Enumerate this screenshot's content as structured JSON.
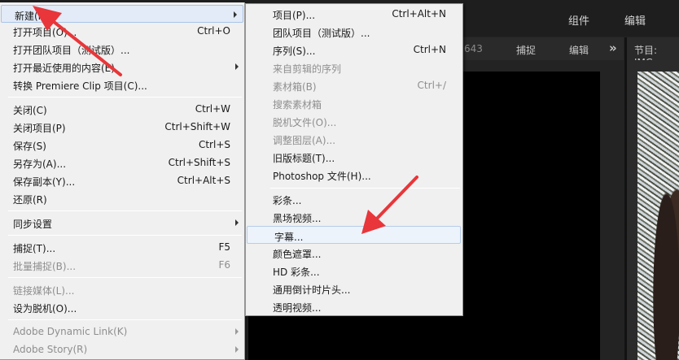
{
  "workspace": {
    "tab_assembly": "组件",
    "tab_editing": "编辑"
  },
  "source_panel": {
    "clip_suffix": "643",
    "tab_capture": "捕捉",
    "tab_edit": "编辑",
    "expand_glyph": "»"
  },
  "program_panel": {
    "title": "节目: IMG"
  },
  "file_menu": {
    "items": [
      {
        "label": "新建(N)",
        "shortcut": "",
        "submenu": true,
        "disabled": false,
        "highlighted": true
      },
      {
        "label": "打开项目(O)...",
        "shortcut": "Ctrl+O",
        "submenu": false,
        "disabled": false
      },
      {
        "label": "打开团队项目（测试版）...",
        "shortcut": "",
        "submenu": false,
        "disabled": false
      },
      {
        "label": "打开最近使用的内容(E)",
        "shortcut": "",
        "submenu": true,
        "disabled": false
      },
      {
        "label": "转换 Premiere Clip 项目(C)...",
        "shortcut": "",
        "submenu": false,
        "disabled": false
      },
      {
        "label": "关闭(C)",
        "shortcut": "Ctrl+W",
        "submenu": false,
        "disabled": false
      },
      {
        "label": "关闭项目(P)",
        "shortcut": "Ctrl+Shift+W",
        "submenu": false,
        "disabled": false
      },
      {
        "label": "保存(S)",
        "shortcut": "Ctrl+S",
        "submenu": false,
        "disabled": false
      },
      {
        "label": "另存为(A)...",
        "shortcut": "Ctrl+Shift+S",
        "submenu": false,
        "disabled": false
      },
      {
        "label": "保存副本(Y)...",
        "shortcut": "Ctrl+Alt+S",
        "submenu": false,
        "disabled": false
      },
      {
        "label": "还原(R)",
        "shortcut": "",
        "submenu": false,
        "disabled": false
      },
      {
        "label": "同步设置",
        "shortcut": "",
        "submenu": true,
        "disabled": false
      },
      {
        "label": "捕捉(T)...",
        "shortcut": "F5",
        "submenu": false,
        "disabled": false
      },
      {
        "label": "批量捕捉(B)...",
        "shortcut": "F6",
        "submenu": false,
        "disabled": true
      },
      {
        "label": "链接媒体(L)...",
        "shortcut": "",
        "submenu": false,
        "disabled": true
      },
      {
        "label": "设为脱机(O)...",
        "shortcut": "",
        "submenu": false,
        "disabled": false
      },
      {
        "label": "Adobe Dynamic Link(K)",
        "shortcut": "",
        "submenu": true,
        "disabled": true
      },
      {
        "label": "Adobe Story(R)",
        "shortcut": "",
        "submenu": true,
        "disabled": true
      }
    ]
  },
  "new_submenu": {
    "items": [
      {
        "label": "项目(P)...",
        "shortcut": "Ctrl+Alt+N",
        "disabled": false
      },
      {
        "label": "团队项目（测试版）...",
        "shortcut": "",
        "disabled": false
      },
      {
        "label": "序列(S)...",
        "shortcut": "Ctrl+N",
        "disabled": false
      },
      {
        "label": "来自剪辑的序列",
        "shortcut": "",
        "disabled": true
      },
      {
        "label": "素材箱(B)",
        "shortcut": "Ctrl+/",
        "disabled": true
      },
      {
        "label": "搜索素材箱",
        "shortcut": "",
        "disabled": true
      },
      {
        "label": "脱机文件(O)...",
        "shortcut": "",
        "disabled": true
      },
      {
        "label": "调整图层(A)...",
        "shortcut": "",
        "disabled": true
      },
      {
        "label": "旧版标题(T)...",
        "shortcut": "",
        "disabled": false
      },
      {
        "label": "Photoshop 文件(H)...",
        "shortcut": "",
        "disabled": false
      },
      {
        "label": "彩条...",
        "shortcut": "",
        "disabled": false
      },
      {
        "label": "黑场视频...",
        "shortcut": "",
        "disabled": false
      },
      {
        "label": "字幕...",
        "shortcut": "",
        "disabled": false,
        "highlighted": true
      },
      {
        "label": "颜色遮罩...",
        "shortcut": "",
        "disabled": false
      },
      {
        "label": "HD 彩条...",
        "shortcut": "",
        "disabled": false
      },
      {
        "label": "通用倒计时片头...",
        "shortcut": "",
        "disabled": false
      },
      {
        "label": "透明视频...",
        "shortcut": "",
        "disabled": false
      }
    ]
  },
  "annotations": {
    "arrow_color": "#e8363a"
  }
}
